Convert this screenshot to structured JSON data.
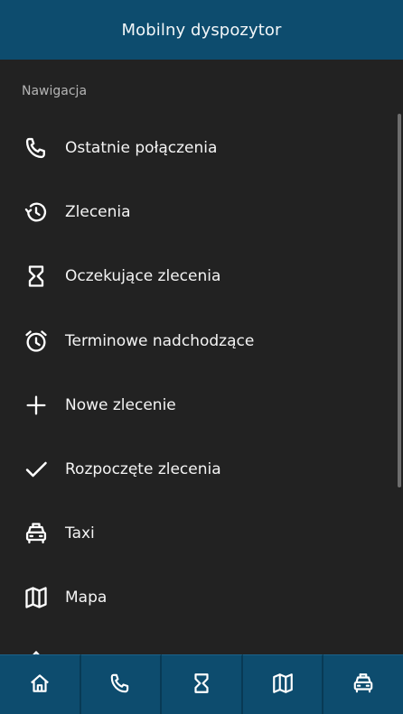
{
  "header": {
    "title": "Mobilny dyspozytor"
  },
  "drawer": {
    "section_label": "Nawigacja",
    "items": [
      {
        "label": "Ostatnie połączenia",
        "icon": "phone-icon"
      },
      {
        "label": "Zlecenia",
        "icon": "history-icon"
      },
      {
        "label": "Oczekujące zlecenia",
        "icon": "hourglass-icon"
      },
      {
        "label": "Terminowe nadchodzące",
        "icon": "alarm-clock-icon"
      },
      {
        "label": "Nowe zlecenie",
        "icon": "plus-icon"
      },
      {
        "label": "Rozpoczęte zlecenia",
        "icon": "checkmark-icon"
      },
      {
        "label": "Taxi",
        "icon": "taxi-icon"
      },
      {
        "label": "Mapa",
        "icon": "map-icon"
      }
    ]
  },
  "bottom_bar": {
    "buttons": [
      {
        "icon": "home-icon"
      },
      {
        "icon": "phone-icon"
      },
      {
        "icon": "hourglass-icon"
      },
      {
        "icon": "map-icon"
      },
      {
        "icon": "taxi-icon"
      }
    ]
  },
  "colors": {
    "header_bg": "#0d4c6e",
    "drawer_bg": "#222222",
    "text": "#f4f4f4",
    "muted_text": "#b5b5b5"
  }
}
